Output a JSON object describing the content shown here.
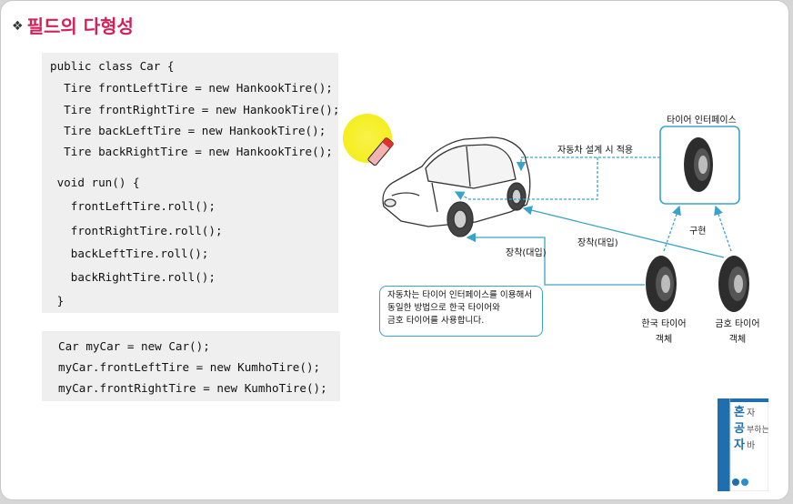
{
  "slide": {
    "bullet": "❖",
    "title": "필드의 다형성"
  },
  "code_block_1": {
    "lines": [
      "public class Car {",
      "  Tire frontLeftTire = new HankookTire();",
      "  Tire frontRightTire = new HankookTire();",
      "  Tire backLeftTire = new HankookTire();",
      "  Tire backRightTire = new HankookTire();",
      " void run() {",
      "   frontLeftTire.roll();",
      "   frontRightTire.roll();",
      "   backLeftTire.roll();",
      "   backRightTire.roll();",
      " }"
    ]
  },
  "code_block_2": {
    "lines": [
      "Car myCar = new Car();",
      "myCar.frontLeftTire = new KumhoTire();",
      "myCar.frontRightTire = new KumhoTire();"
    ]
  },
  "diagram": {
    "interface_label": "타이어 인터페이스",
    "design_label": "자동차 설계 시 적용",
    "implement_label": "구현",
    "mount_label_1": "장착(대입)",
    "mount_label_2": "장착(대입)",
    "hankook_label_1": "한국 타이어",
    "hankook_label_2": "객체",
    "kumho_label_1": "금호 타이어",
    "kumho_label_2": "객체",
    "note_lines": [
      "자동차는 타이어 인터페이스를 이용해서",
      "동일한 방법으로 한국 타이어와",
      "금호 타이어를 사용합니다."
    ],
    "arrow_color": "#3aa3c9",
    "highlight_color": "#f5ee1f",
    "title_color": "#d4205a",
    "code_bg": "#efefef"
  },
  "book": {
    "title_line_1": "혼자",
    "title_line_2": "공부하는",
    "title_line_3": "자바"
  }
}
